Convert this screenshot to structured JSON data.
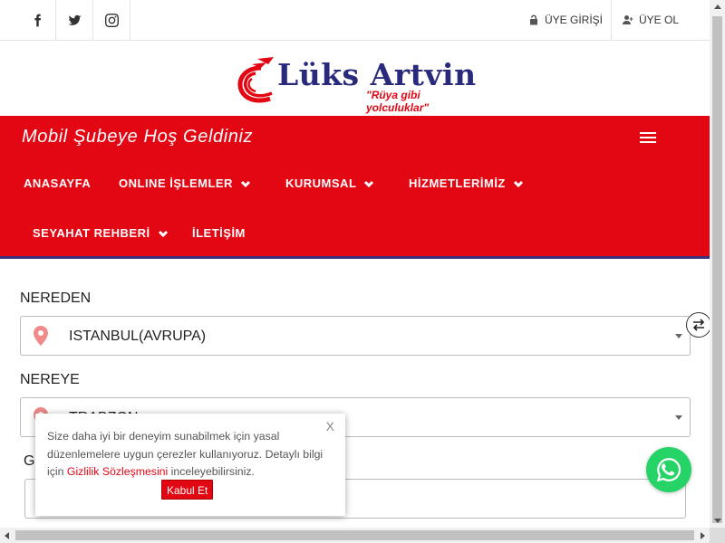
{
  "topbar": {
    "social": [
      {
        "icon": "facebook-icon"
      },
      {
        "icon": "twitter-icon"
      },
      {
        "icon": "instagram-icon"
      }
    ],
    "login_label": "ÜYE GİRİŞİ",
    "register_label": "ÜYE OL"
  },
  "brand": {
    "name": "Lüks Artvin",
    "slogan": "\"Rüya gibi yolculuklar\"",
    "primary_color": "#e30613",
    "logo_text_color": "#2a2a7c"
  },
  "nav": {
    "welcome": "Mobil Şubeye Hoş Geldiniz",
    "items": [
      {
        "label": "ANASAYFA"
      },
      {
        "label": "ONLINE İŞLEMLER"
      },
      {
        "label": "KURUMSAL"
      },
      {
        "label": "HİZMETLERİMİZ"
      },
      {
        "label": "SEYAHAT REHBERİ"
      },
      {
        "label": "İLETİŞİM"
      }
    ]
  },
  "form": {
    "from_label": "NEREDEN",
    "from_value": "ISTANBUL(AVRUPA)",
    "to_label": "NEREYE",
    "to_value": "TRABZON",
    "date_label": "G"
  },
  "cookie": {
    "close": "X",
    "text_before": "Size daha iyi bir deneyim sunabilmek için yasal düzenlemelere uygun çerezler kullanıyoruz. Detaylı bilgi için ",
    "link": "Gizlilik Sözleşmesini",
    "text_after": " inceleyebilirsiniz.",
    "accept": "Kabul Et"
  },
  "widgets": {
    "whatsapp_icon": "whatsapp-icon",
    "swap_icon": "swap-icon"
  }
}
